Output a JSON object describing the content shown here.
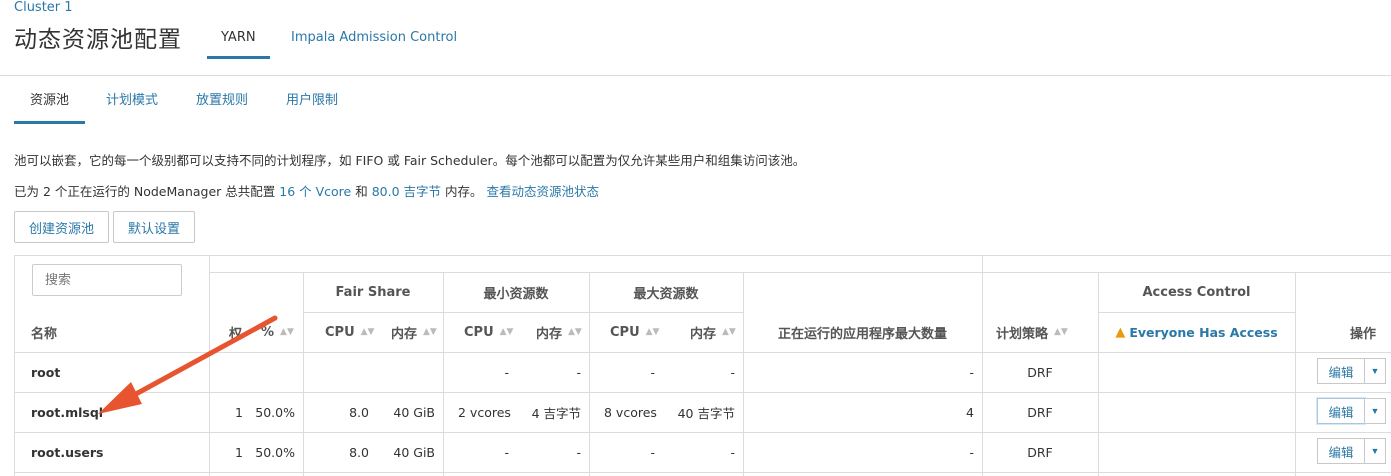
{
  "header": {
    "breadcrumb": "Cluster 1",
    "title": "动态资源池配置",
    "tabs": [
      {
        "label": "YARN",
        "active": true
      },
      {
        "label": "Impala Admission Control",
        "active": false
      }
    ]
  },
  "subtabs": [
    {
      "label": "资源池",
      "active": true
    },
    {
      "label": "计划模式",
      "active": false
    },
    {
      "label": "放置规则",
      "active": false
    },
    {
      "label": "用户限制",
      "active": false
    }
  ],
  "description": {
    "line1": "池可以嵌套，它的每一个级别都可以支持不同的计划程序，如 FIFO 或 Fair Scheduler。每个池都可以配置为仅允许某些用户和组集访问该池。",
    "line2_prefix": "已为 2 个正在运行的 NodeManager 总共配置 ",
    "vcore_link": "16 个 Vcore",
    "line2_and": " 和 ",
    "mem_link": "80.0 吉字节",
    "line2_suffix": " 内存。 ",
    "status_link": "查看动态资源池状态"
  },
  "buttons": {
    "create_pool": "创建资源池",
    "default_settings": "默认设置"
  },
  "table": {
    "search_placeholder": "搜索",
    "group_headers": {
      "fair_share": "Fair Share",
      "min_resources": "最小资源数",
      "max_resources": "最大资源数",
      "access_control": "Access Control"
    },
    "columns": {
      "name": "名称",
      "weight": "权",
      "percent": "%",
      "cpu": "CPU",
      "memory": "内存",
      "max_running_apps": "正在运行的应用程序最大数量",
      "scheduling_policy": "计划策略",
      "everyone_access": "Everyone Has Access",
      "actions": "操作"
    },
    "edit_label": "编辑",
    "rows": [
      {
        "name": "root",
        "weight": "",
        "percent": "",
        "fs_cpu": "",
        "fs_mem": "",
        "min_cpu": "-",
        "min_mem": "-",
        "max_cpu": "-",
        "max_mem": "-",
        "max_apps": "-",
        "policy": "DRF"
      },
      {
        "name": "root.mlsql",
        "weight": "1",
        "percent": "50.0%",
        "fs_cpu": "8.0",
        "fs_mem": "40 GiB",
        "min_cpu": "2 vcores",
        "min_mem": "4 吉字节",
        "max_cpu": "8 vcores",
        "max_mem": "40 吉字节",
        "max_apps": "4",
        "policy": "DRF"
      },
      {
        "name": "root.users",
        "weight": "1",
        "percent": "50.0%",
        "fs_cpu": "8.0",
        "fs_mem": "40 GiB",
        "min_cpu": "-",
        "min_mem": "-",
        "max_cpu": "-",
        "max_mem": "-",
        "max_apps": "-",
        "policy": "DRF"
      }
    ]
  },
  "colors": {
    "link": "#2a78a8",
    "annotation_arrow": "#e8542f",
    "warning": "#e79b11"
  }
}
